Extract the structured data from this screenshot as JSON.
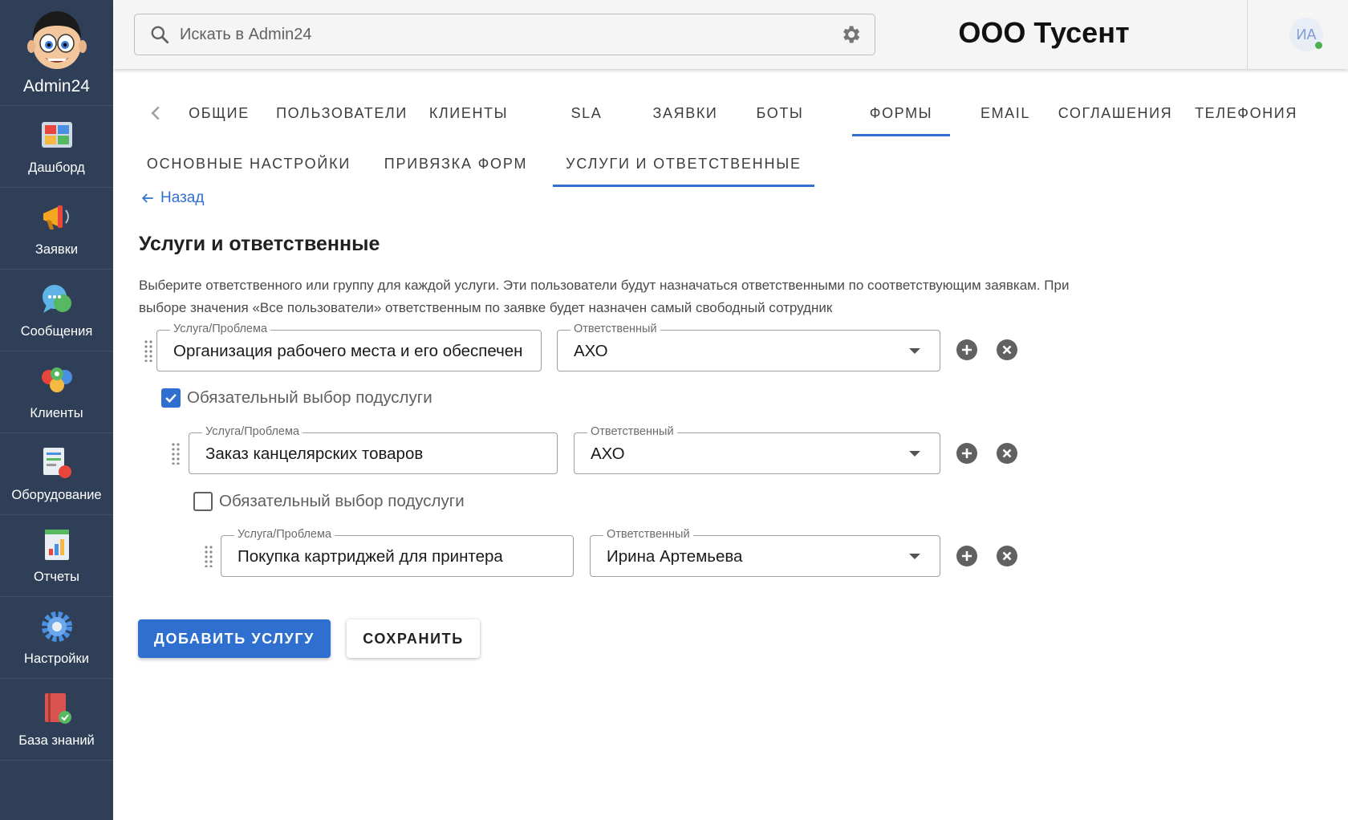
{
  "app": {
    "name": "Admin24"
  },
  "sidebar": {
    "items": [
      {
        "label": "Дашборд",
        "icon": "dashboard-icon"
      },
      {
        "label": "Заявки",
        "icon": "megaphone-icon"
      },
      {
        "label": "Сообщения",
        "icon": "chat-bubble-icon"
      },
      {
        "label": "Клиенты",
        "icon": "users-icon"
      },
      {
        "label": "Оборудование",
        "icon": "equipment-icon"
      },
      {
        "label": "Отчеты",
        "icon": "report-icon"
      },
      {
        "label": "Настройки",
        "icon": "gear-icon"
      },
      {
        "label": "База знаний",
        "icon": "knowledge-book-icon"
      }
    ]
  },
  "header": {
    "search_placeholder": "Искать в Admin24",
    "company": "ООО Тусент",
    "avatar_initials": "ИА"
  },
  "tabs": [
    {
      "label": "ОБЩИЕ"
    },
    {
      "label": "ПОЛЬЗОВАТЕЛИ"
    },
    {
      "label": "КЛИЕНТЫ"
    },
    {
      "label": "SLA"
    },
    {
      "label": "ЗАЯВКИ"
    },
    {
      "label": "БОТЫ"
    },
    {
      "label": "ФОРМЫ"
    },
    {
      "label": "EMAIL"
    },
    {
      "label": "СОГЛАШЕНИЯ"
    },
    {
      "label": "ТЕЛЕФОНИЯ"
    }
  ],
  "subtabs": [
    {
      "label": "ОСНОВНЫЕ НАСТРОЙКИ"
    },
    {
      "label": "ПРИВЯЗКА ФОРМ"
    },
    {
      "label": "УСЛУГИ И ОТВЕТСТВЕННЫЕ"
    }
  ],
  "back_label": "Назад",
  "page": {
    "title": "Услуги и ответственные",
    "description": "Выберите ответственного или группу для каждой услуги. Эти пользователи будут назначаться ответственными по соответствующим заявкам. При выборе значения «Все пользователи» ответственным по заявке будет назначен самый свободный сотрудник"
  },
  "services": [
    {
      "service_legend": "Услуга/Проблема",
      "service_value": "Организация рабочего места и его обеспечен",
      "responsible_legend": "Ответственный",
      "responsible_value": "АХО"
    },
    {
      "checkbox_label": "Обязательный выбор подуслуги",
      "checked": true,
      "service_legend": "Услуга/Проблема",
      "service_value": "Заказ канцелярских товаров",
      "responsible_legend": "Ответственный",
      "responsible_value": "АХО"
    },
    {
      "checkbox_label": "Обязательный выбор подуслуги",
      "checked": false,
      "service_legend": "Услуга/Проблема",
      "service_value": "Покупка картриджей для принтера",
      "responsible_legend": "Ответственный",
      "responsible_value": "Ирина Артемьева"
    }
  ],
  "buttons": {
    "add_service": "ДОБАВИТЬ УСЛУГУ",
    "save": "СОХРАНИТЬ"
  },
  "colors": {
    "sidebar_bg": "#2f3f57",
    "accent": "#2f6fd0",
    "online": "#4caf50"
  }
}
